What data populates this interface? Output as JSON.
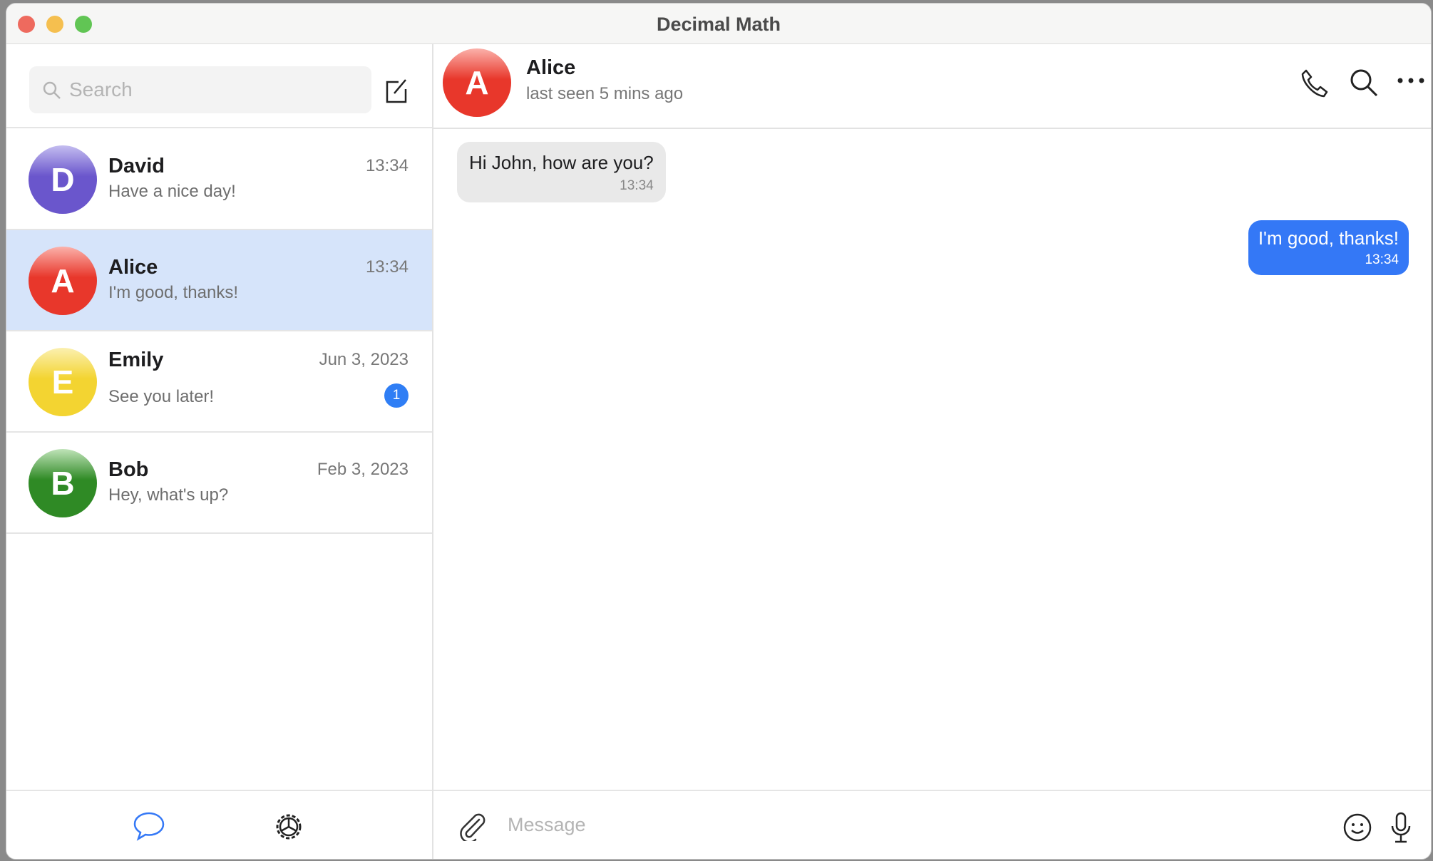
{
  "window": {
    "title": "Decimal Math"
  },
  "sidebar": {
    "search_placeholder": "Search",
    "chats": [
      {
        "initial": "D",
        "name": "David",
        "time": "13:34",
        "preview": "Have a nice day!",
        "color": "#6a56cc"
      },
      {
        "initial": "A",
        "name": "Alice",
        "time": "13:34",
        "preview": "I'm good, thanks!",
        "color": "#e8372b",
        "selected": true
      },
      {
        "initial": "E",
        "name": "Emily",
        "time": "Jun 3, 2023",
        "preview": "See you later!",
        "unread": "1",
        "color": "#f3d431"
      },
      {
        "initial": "B",
        "name": "Bob",
        "time": "Feb 3, 2023",
        "preview": "Hey, what's up?",
        "color": "#2f8a25"
      }
    ]
  },
  "chat": {
    "initial": "A",
    "name": "Alice",
    "status": "last seen 5 mins ago",
    "messages": [
      {
        "text": "Hi John, how are you?",
        "time": "13:34",
        "side": "incoming"
      },
      {
        "text": "I'm good, thanks!",
        "time": "13:34",
        "side": "outgoing"
      }
    ],
    "input_placeholder": "Message"
  },
  "colors": {
    "accent": "#3478f6",
    "selected_row": "#d6e4fa"
  }
}
